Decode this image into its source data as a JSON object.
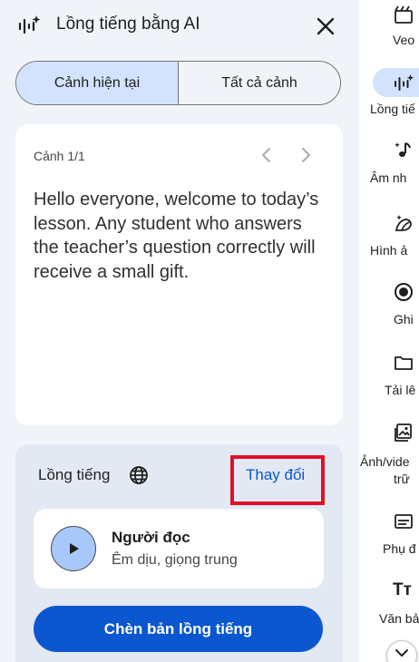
{
  "header": {
    "title": "Lồng tiếng bằng AI"
  },
  "scene_tabs": {
    "current": "Cảnh hiện tại",
    "all": "Tất cả cảnh",
    "active": "current"
  },
  "scene": {
    "label": "Cảnh 1/1",
    "text": "Hello everyone, welcome to today’s lesson. Any student who answers the teacher’s question correctly will receive a small gift."
  },
  "voice": {
    "label": "Lồng tiếng",
    "change_label": "Thay đổi",
    "reader_name": "Người đọc",
    "reader_desc": "Êm dịu, giọng trung",
    "insert_label": "Chèn bản lồng tiếng"
  },
  "rail": {
    "items": [
      {
        "label": "Veo",
        "icon": "clapperboard-icon"
      },
      {
        "label": "Lồng tiế",
        "icon": "ai-voice-icon",
        "active": true
      },
      {
        "label": "Âm nh",
        "icon": "music-note-icon"
      },
      {
        "label": "Hình ả",
        "icon": "image-icon"
      },
      {
        "label": "Ghi",
        "icon": "record-icon"
      },
      {
        "label": "Tải lê",
        "icon": "folder-icon"
      },
      {
        "label": "Ảnh/vide",
        "label2": "trữ",
        "icon": "stock-media-icon"
      },
      {
        "label": "Phụ đ",
        "icon": "subtitles-icon"
      },
      {
        "label": "Văn bả",
        "icon": "text-icon"
      }
    ]
  },
  "colors": {
    "accent": "#0b57d0",
    "panel_bg": "#f0f4f9",
    "active_bg": "#d3e3fd",
    "highlight": "#e0102a"
  }
}
